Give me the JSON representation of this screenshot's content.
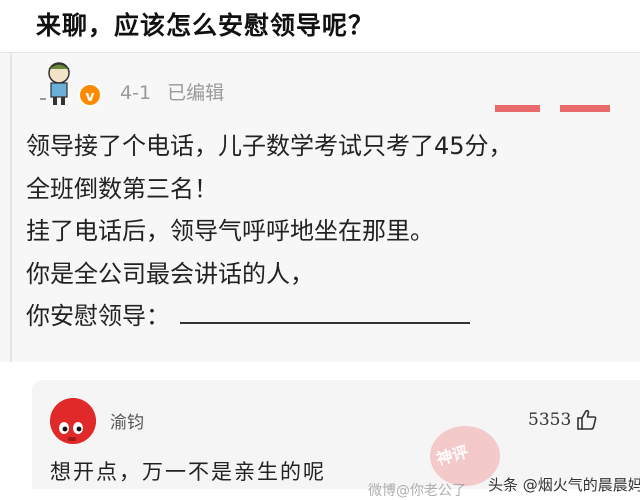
{
  "header": {
    "title": "来聊，应该怎么安慰领导呢？"
  },
  "post": {
    "date": "4-1",
    "edit_status": "已编辑",
    "verified_badge": "v",
    "lines": [
      "领导接了个电话，儿子数学考试只考了45分，",
      "全班倒数第三名！",
      "挂了电话后，领导气呼呼地坐在那里。",
      "你是全公司最会讲话的人，",
      "你安慰领导："
    ]
  },
  "comment": {
    "username": "渝钧",
    "likes": "5353",
    "text": "想开点，万一不是亲生的呢"
  },
  "stamp": {
    "text": "神评"
  },
  "watermarks": {
    "overlay": "微博@你老公了",
    "source": "头条 @烟火气的晨晨妈"
  },
  "colors": {
    "accent_orange": "#ff8a00",
    "avatar_red": "#e02a2a"
  },
  "icons": [
    "cartoon-avatar-icon",
    "verified-icon",
    "thumbs-up-icon",
    "comment-avatar-icon"
  ]
}
